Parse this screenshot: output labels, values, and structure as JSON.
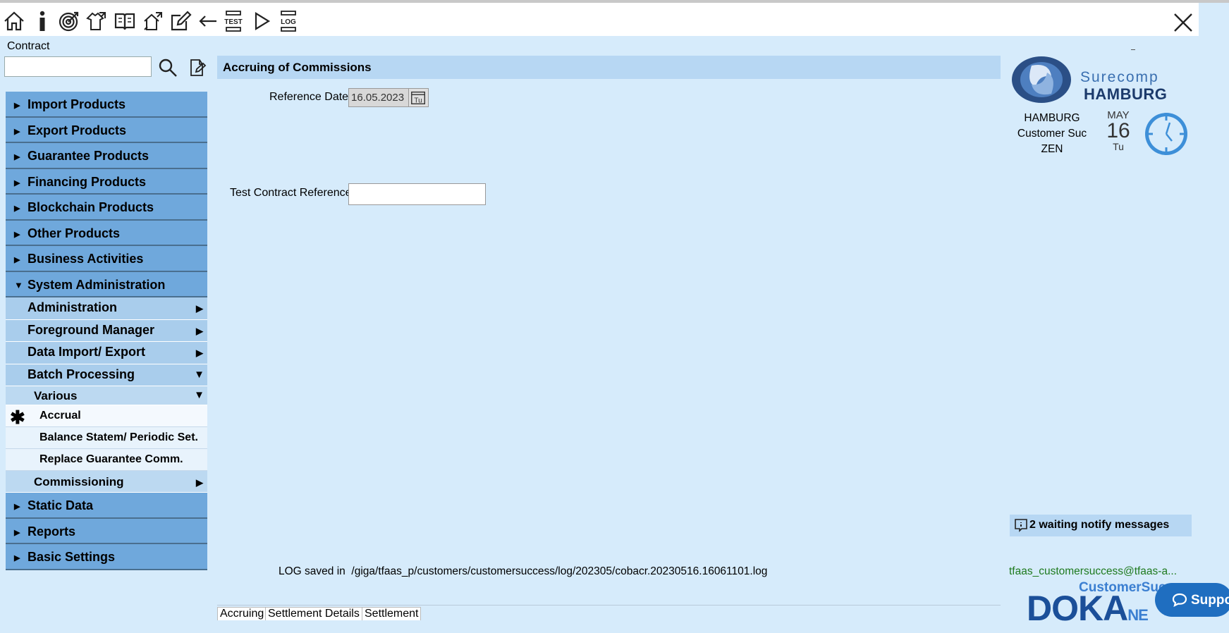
{
  "toolbar": {
    "icons": [
      "home-icon",
      "info-icon",
      "target-icon",
      "handover-icon",
      "book-icon",
      "switch-icon",
      "edit-icon",
      "back-icon",
      "test-icon",
      "play-icon",
      "log-icon"
    ],
    "test_text": "TEST",
    "log_text": "LOG"
  },
  "search": {
    "label": "Contract",
    "value": "",
    "placeholder": ""
  },
  "nav": {
    "import_products": "Import Products",
    "export_products": "Export Products",
    "guarantee_products": "Guarantee Products",
    "financing_products": "Financing Products",
    "blockchain_products": "Blockchain Products",
    "other_products": "Other Products",
    "business_activities": "Business Activities",
    "system_administration": "System Administration",
    "administration": "Administration",
    "foreground_manager": "Foreground Manager",
    "data_import_export": "Data Import/ Export",
    "batch_processing": "Batch Processing",
    "various": "Various",
    "accrual": "Accrual",
    "balance_statem": "Balance Statem/ Periodic Set.",
    "replace_guarantee": "Replace Guarantee Comm.",
    "commissioning": "Commissioning",
    "static_data": "Static Data",
    "reports": "Reports",
    "basic_settings": "Basic Settings",
    "active_item": "Accrual"
  },
  "form": {
    "title": "Accruing of Commissions",
    "reference_date_label": "Reference Date",
    "reference_date_value": "16.05.2023",
    "calendar_button_text": "Tu",
    "test_contract_label": "Test Contract Reference",
    "test_contract_value": ""
  },
  "log": {
    "label": "LOG saved in",
    "path": "/giga/tfaas_p/customers/customersuccess/log/202305/cobacr.20230516.16061101.log"
  },
  "tabs": {
    "accruing": "Accruing",
    "settlement_details": "Settlement Details",
    "settlement": "Settlement"
  },
  "brand": {
    "name_top": "Surecomp",
    "name_bottom": "HAMBURG",
    "location": "HAMBURG",
    "customer": "Customer Suc",
    "zone": "ZEN"
  },
  "date": {
    "month": "MAY",
    "day": "16",
    "weekday": "Tu"
  },
  "notifications": {
    "text": "2 waiting notify messages",
    "count": 2
  },
  "user": {
    "email": "tfaas_customersuccess@tfaas-a..."
  },
  "footer_brand": {
    "customer_success": "CustomerSucce",
    "doka": "DOKA",
    "ne": "NE"
  },
  "support": {
    "label": "Suppo"
  },
  "colors": {
    "background": "#d6ebfb",
    "nav_primary": "#6fa8dc",
    "nav_sub": "#a9cdec",
    "title_bar": "#b7d7f3",
    "support": "#1f6ec0",
    "email": "#1e7a1e"
  }
}
